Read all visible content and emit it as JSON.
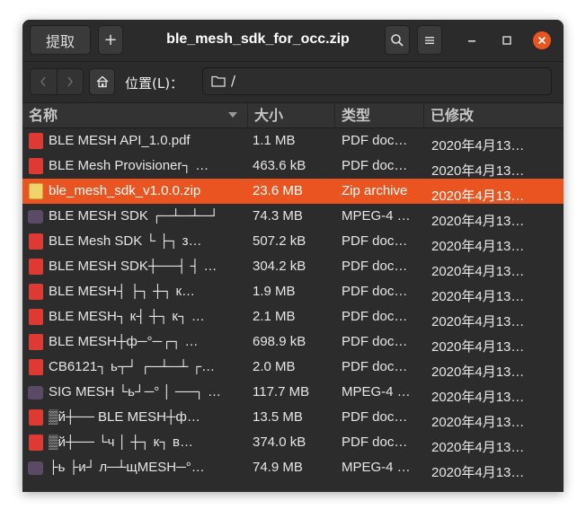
{
  "window": {
    "title": "ble_mesh_sdk_for_occ.zip",
    "extract_label": "提取",
    "new_label": "+"
  },
  "toolbar": {
    "location_label": "位置(L)：",
    "path": "/"
  },
  "columns": {
    "name": "名称",
    "size": "大小",
    "type": "类型",
    "modified": "已修改"
  },
  "files": [
    {
      "name": "BLE MESH API_1.0.pdf",
      "size": "1.1 MB",
      "type": "PDF doc…",
      "modified": "2020年4月13…",
      "icon": "pdf"
    },
    {
      "name": "BLE Mesh Provisioner┐ …",
      "size": "463.6 kB",
      "type": "PDF doc…",
      "modified": "2020年4月13…",
      "icon": "pdf"
    },
    {
      "name": "ble_mesh_sdk_v1.0.0.zip",
      "size": "23.6 MB",
      "type": "Zip archive",
      "modified": "2020年4月13…",
      "icon": "zip",
      "selected": true
    },
    {
      "name": "BLE  MESH  SDK  ┌─┴─┴─┘",
      "size": "74.3 MB",
      "type": "MPEG-4 …",
      "modified": "2020年4月13…",
      "icon": "video"
    },
    {
      "name": "BLE Mesh SDK └ ├┐ з…",
      "size": "507.2 kB",
      "type": "PDF doc…",
      "modified": "2020年4月13…",
      "icon": "pdf"
    },
    {
      "name": "BLE MESH SDK┼──┤ ┤ …",
      "size": "304.2 kB",
      "type": "PDF doc…",
      "modified": "2020年4月13…",
      "icon": "pdf"
    },
    {
      "name": "BLE MESH┤  ├┐ ┼┐ к…",
      "size": "1.9 MB",
      "type": "PDF doc…",
      "modified": "2020年4月13…",
      "icon": "pdf"
    },
    {
      "name": "BLE MESH┐ к┤ ┼┐ к┐ …",
      "size": "2.1 MB",
      "type": "PDF doc…",
      "modified": "2020年4月13…",
      "icon": "pdf"
    },
    {
      "name": "BLE MESH┼ф─°─┌┐ …",
      "size": "698.9 kB",
      "type": "PDF doc…",
      "modified": "2020年4月13…",
      "icon": "pdf"
    },
    {
      "name": "CB6121┐ ь┬┘  ┌─┴─┴ ┌…",
      "size": "2.0 MB",
      "type": "PDF doc…",
      "modified": "2020年4月13…",
      "icon": "pdf"
    },
    {
      "name": "SIG MESH └ь┘─° │ ──┐ …",
      "size": "117.7 MB",
      "type": "MPEG-4 …",
      "modified": "2020年4月13…",
      "icon": "video"
    },
    {
      "name": "▒й┼──  BLE MESH┼ф…",
      "size": "13.5 MB",
      "type": "PDF doc…",
      "modified": "2020年4月13…",
      "icon": "pdf"
    },
    {
      "name": "▒й┼──   └ч │ ┼┐ к┐ в…",
      "size": "374.0 kB",
      "type": "PDF doc…",
      "modified": "2020年4月13…",
      "icon": "pdf"
    },
    {
      "name": " ├ь ├и┘  л─┴щMESH─°…",
      "size": "74.9 MB",
      "type": "MPEG-4 …",
      "modified": "2020年4月13…",
      "icon": "video"
    }
  ]
}
